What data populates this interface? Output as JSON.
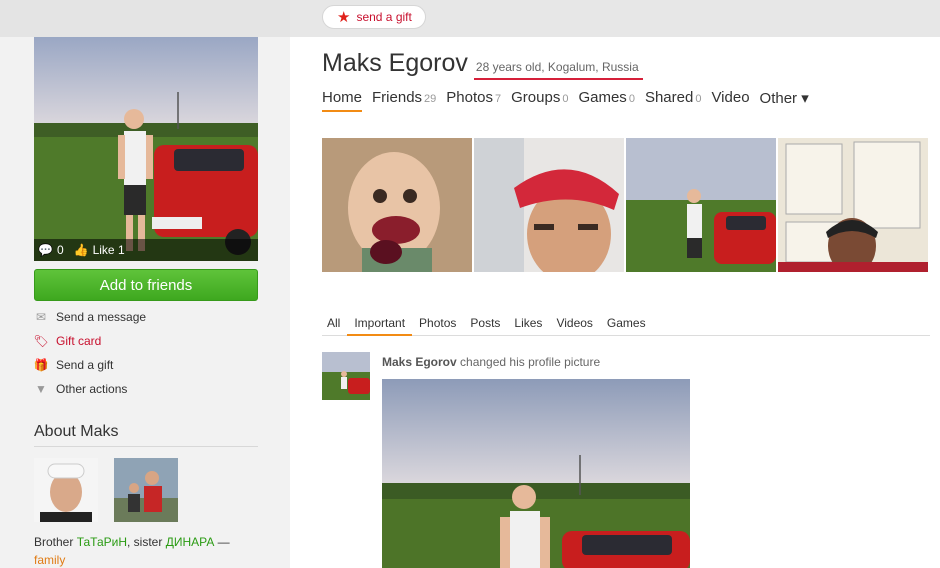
{
  "topbar": {
    "gift_label": "send a gift",
    "gift_icon": "star-icon"
  },
  "sidebar": {
    "avatar_comments": "0",
    "avatar_likes": "Like 1",
    "add_friends": "Add to friends",
    "actions": [
      {
        "label": "Send a message",
        "icon": "envelope-icon"
      },
      {
        "label": "Gift card",
        "icon": "gift-card-icon"
      },
      {
        "label": "Send a gift",
        "icon": "gift-icon"
      },
      {
        "label": "Other actions",
        "icon": "triangle-down-icon"
      }
    ],
    "about_title": "About Maks",
    "relatives": {
      "brother_label": "Brother",
      "brother_name": "ТаТаРиН",
      "sister_label": ", sister",
      "sister_name": "ДИНАРА",
      "dash": " —",
      "group": "family"
    }
  },
  "profile": {
    "name": "Maks Egorov",
    "meta": "28 years old, Kogalum, Russia"
  },
  "nav": [
    {
      "label": "Home",
      "count": ""
    },
    {
      "label": "Friends",
      "count": "29"
    },
    {
      "label": "Photos",
      "count": "7"
    },
    {
      "label": "Groups",
      "count": "0"
    },
    {
      "label": "Games",
      "count": "0"
    },
    {
      "label": "Shared",
      "count": "0"
    },
    {
      "label": "Video",
      "count": ""
    },
    {
      "label": "Other ▾",
      "count": ""
    }
  ],
  "feed_tabs": [
    "All",
    "Important",
    "Photos",
    "Posts",
    "Likes",
    "Videos",
    "Games"
  ],
  "post": {
    "author": "Maks Egorov",
    "action": " changed his profile picture"
  },
  "colors": {
    "accent_orange": "#f28b14",
    "button_green": "#4cb52a",
    "gift_red": "#c8102e",
    "underline_red": "#d6203a"
  }
}
